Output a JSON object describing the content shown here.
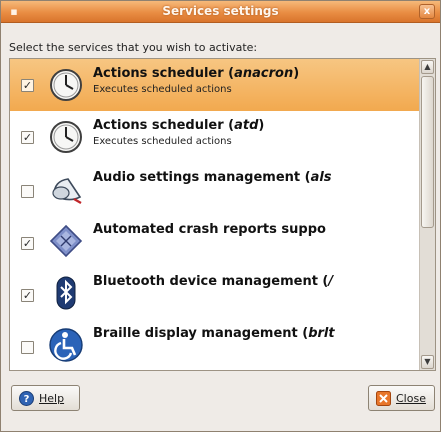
{
  "window": {
    "title": "Services settings",
    "close_glyph": "x"
  },
  "instruction": "Select the services that you wish to activate:",
  "services": [
    {
      "name": "Actions scheduler (anacron)",
      "description": "Executes scheduled actions",
      "checked": true,
      "selected": true,
      "icon": "clock-icon"
    },
    {
      "name": "Actions scheduler (atd)",
      "description": "Executes scheduled actions",
      "checked": true,
      "selected": false,
      "icon": "clock-icon"
    },
    {
      "name": "Audio settings management (als",
      "description": "",
      "checked": false,
      "selected": false,
      "icon": "speaker-icon"
    },
    {
      "name": "Automated crash reports suppo",
      "description": "",
      "checked": true,
      "selected": false,
      "icon": "crash-report-icon"
    },
    {
      "name": "Bluetooth device management (",
      "description": "",
      "checked": true,
      "selected": false,
      "icon": "bluetooth-icon"
    },
    {
      "name": "Braille display management (brlt",
      "description": "",
      "checked": false,
      "selected": false,
      "icon": "accessibility-icon"
    }
  ],
  "buttons": {
    "help_label": "Help",
    "close_label": "Close"
  },
  "scrollbar": {
    "visible_fraction": 0.55,
    "position": 0.0
  },
  "colors": {
    "titlebar": "#e98d43",
    "selection": "#f2a94f",
    "background": "#efebe7"
  }
}
